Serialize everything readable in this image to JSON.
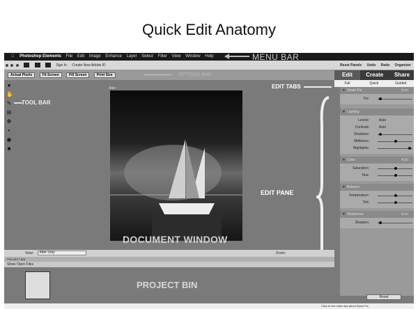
{
  "slide": {
    "title": "Quick Edit Anatomy"
  },
  "menubar": {
    "app_name": "Photoshop Elements",
    "items": [
      "File",
      "Edit",
      "Image",
      "Enhance",
      "Layer",
      "Select",
      "Filter",
      "View",
      "Window",
      "Help"
    ],
    "annotation": "MENU BAR"
  },
  "topbar": {
    "sign_in": "Sign In",
    "create_id": "Create New Adobe ID",
    "reset_panels": "Reset Panels",
    "undo": "Undo",
    "redo": "Redo",
    "organizer": "Organizer"
  },
  "optbar": {
    "buttons": [
      "Actual Pixels",
      "Fit Screen",
      "Fill Screen",
      "Print Size"
    ],
    "ghost_annotation": "OPTIONS BAR"
  },
  "toolbar": {
    "annotation": "TOOL BAR"
  },
  "document": {
    "tab_label": "After",
    "annotation": "DOCUMENT WINDOW"
  },
  "edit_tabs": {
    "tabs": [
      "Edit",
      "Create",
      "Share"
    ],
    "subtabs": [
      "Full",
      "Quick",
      "Guided"
    ],
    "annotation": "EDIT TABS"
  },
  "edit_pane": {
    "annotation": "EDIT PANE",
    "sections": {
      "smart_fix": {
        "title": "Smart Fix",
        "auto": "Auto",
        "fix": "Fix:"
      },
      "lighting": {
        "title": "Lighting",
        "levels": "Levels:",
        "levels_val": "Auto",
        "contrast": "Contrast:",
        "contrast_val": "Auto",
        "shadows": "Shadows:",
        "midtones": "Midtones:",
        "highlights": "Highlights:"
      },
      "color": {
        "title": "Color",
        "auto": "Auto",
        "saturation": "Saturation:",
        "hue": "Hue:"
      },
      "balance": {
        "title": "Balance",
        "temperature": "Temperature:",
        "tint": "Tint:"
      },
      "sharpness": {
        "title": "Sharpness",
        "auto": "Auto",
        "sharpen": "Sharpen:"
      }
    },
    "reset": "Reset"
  },
  "bottom_bar": {
    "view_label": "View:",
    "view_value": "After Only",
    "zoom_label": "Zoom:"
  },
  "project_bin": {
    "header": "PROJECT BIN",
    "show": "Show Open Files",
    "annotation": "PROJECT BIN"
  },
  "status": {
    "tip": "Click to see video tips about Quick Fix."
  }
}
